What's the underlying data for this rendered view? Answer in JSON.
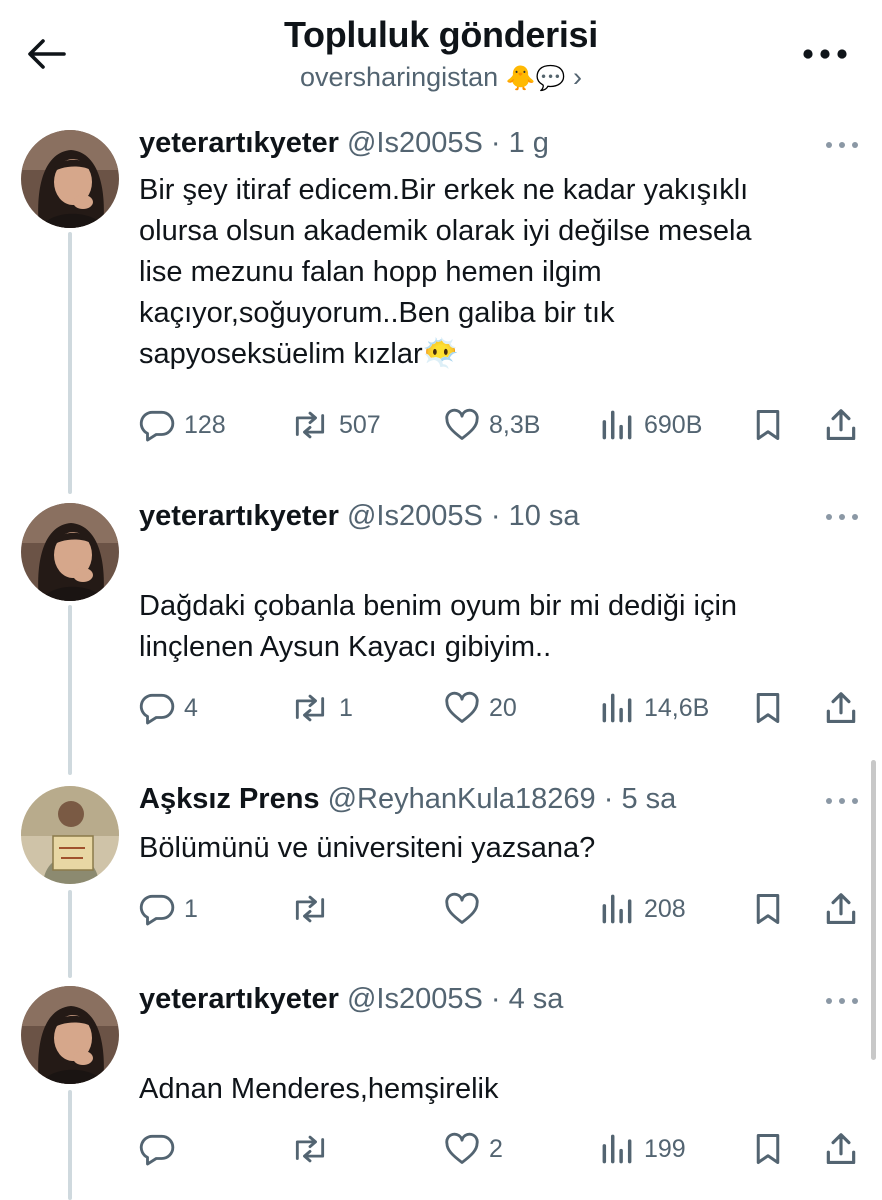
{
  "header": {
    "title": "Topluluk gönderisi",
    "community": "oversharingistan",
    "community_emoji": "🐥💬",
    "chevron": "›",
    "icons": {
      "back": "arrow-left-icon",
      "more": "more-horizontal-icon"
    }
  },
  "posts": [
    {
      "display_name": "yeterartıkyeter",
      "handle": "@Is2005S",
      "time": "· 1 g",
      "text": "Bir şey itiraf edicem.Bir erkek ne kadar yakışıklı\nolursa olsun akademik olarak iyi değilse mesela\nlise mezunu falan hopp hemen ilgim\nkaçıyor,soğuyorum..Ben galiba bir tık\nsapyoseksüelim kızlar😶‍🌫️",
      "replies": "128",
      "reposts": "507",
      "likes": "8,3B",
      "views": "690B"
    },
    {
      "display_name": "yeterartıkyeter",
      "handle": "@Is2005S",
      "time": "· 10 sa",
      "text": "Dağdaki çobanla benim oyum bir mi dediği için\nlinçlenen Aysun Kayacı gibiyim..",
      "replies": "4",
      "reposts": "1",
      "likes": "20",
      "views": "14,6B"
    },
    {
      "display_name": "Aşksız Prens",
      "handle": "@ReyhanKula18269",
      "time": "· 5 sa",
      "text": "Bölümünü ve üniversiteni yazsana?",
      "replies": "1",
      "reposts": "",
      "likes": "",
      "views": "208"
    },
    {
      "display_name": "yeterartıkyeter",
      "handle": "@Is2005S",
      "time": "· 4 sa",
      "text": "Adnan Menderes,hemşirelik",
      "replies": "",
      "reposts": "",
      "likes": "2",
      "views": "199"
    }
  ],
  "colors": {
    "text": "#0f1419",
    "secondary": "#536471",
    "thread_line": "#cfd9de",
    "background": "#ffffff"
  }
}
